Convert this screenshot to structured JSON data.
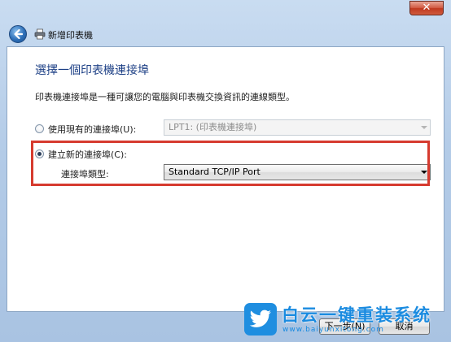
{
  "window": {
    "close_label": "✕",
    "title": "新增印表機"
  },
  "page": {
    "heading": "選擇一個印表機連接埠",
    "description": "印表機連接埠是一種可讓您的電腦與印表機交換資訊的連線類型。"
  },
  "options": {
    "existing": {
      "label": "使用現有的連接埠(U):",
      "selected": false,
      "value": "LPT1: (印表機連接埠)"
    },
    "create_new": {
      "label": "建立新的連接埠(C):",
      "selected": true,
      "type_label": "連接埠類型:",
      "type_value": "Standard TCP/IP Port"
    }
  },
  "footer": {
    "next_label": "下一步(N)",
    "cancel_label": "取消"
  },
  "watermark": {
    "title": "白云一键重装系统",
    "url": "www.baiyunxitong.com"
  },
  "colors": {
    "highlight_border": "#d63b2f",
    "heading": "#1c3f85",
    "watermark": "#1a8be0"
  },
  "icons": [
    "close-icon",
    "back-arrow-icon",
    "printer-icon",
    "dropdown-arrow-icon",
    "twitter-bird-icon"
  ]
}
